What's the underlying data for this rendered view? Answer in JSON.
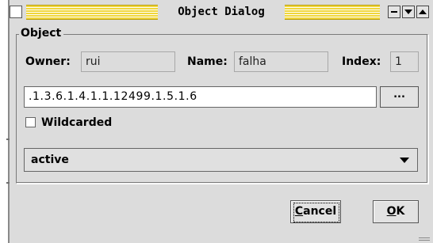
{
  "window": {
    "title": "Object Dialog",
    "controls": [
      "minimize-icon",
      "shade-down-icon",
      "shade-up-icon"
    ]
  },
  "object_group": {
    "legend": "Object",
    "owner_label": "Owner:",
    "owner_value": "rui",
    "name_label": "Name:",
    "name_value": "falha",
    "index_label": "Index:",
    "index_value": "1",
    "oid_value": ".1.3.6.1.4.1.1.12499.1.5.1.6",
    "browse_label": "...",
    "wildcard_label": "Wildcarded",
    "wildcard_checked": false,
    "status_selected": "active"
  },
  "buttons": {
    "cancel_mnemonic": "C",
    "cancel_rest": "ancel",
    "ok_mnemonic": "O",
    "ok_rest": "K"
  },
  "colors": {
    "window_bg": "#dcdcdc",
    "title_stripe": "#f0d63c",
    "field_bg": "#ffffff"
  }
}
